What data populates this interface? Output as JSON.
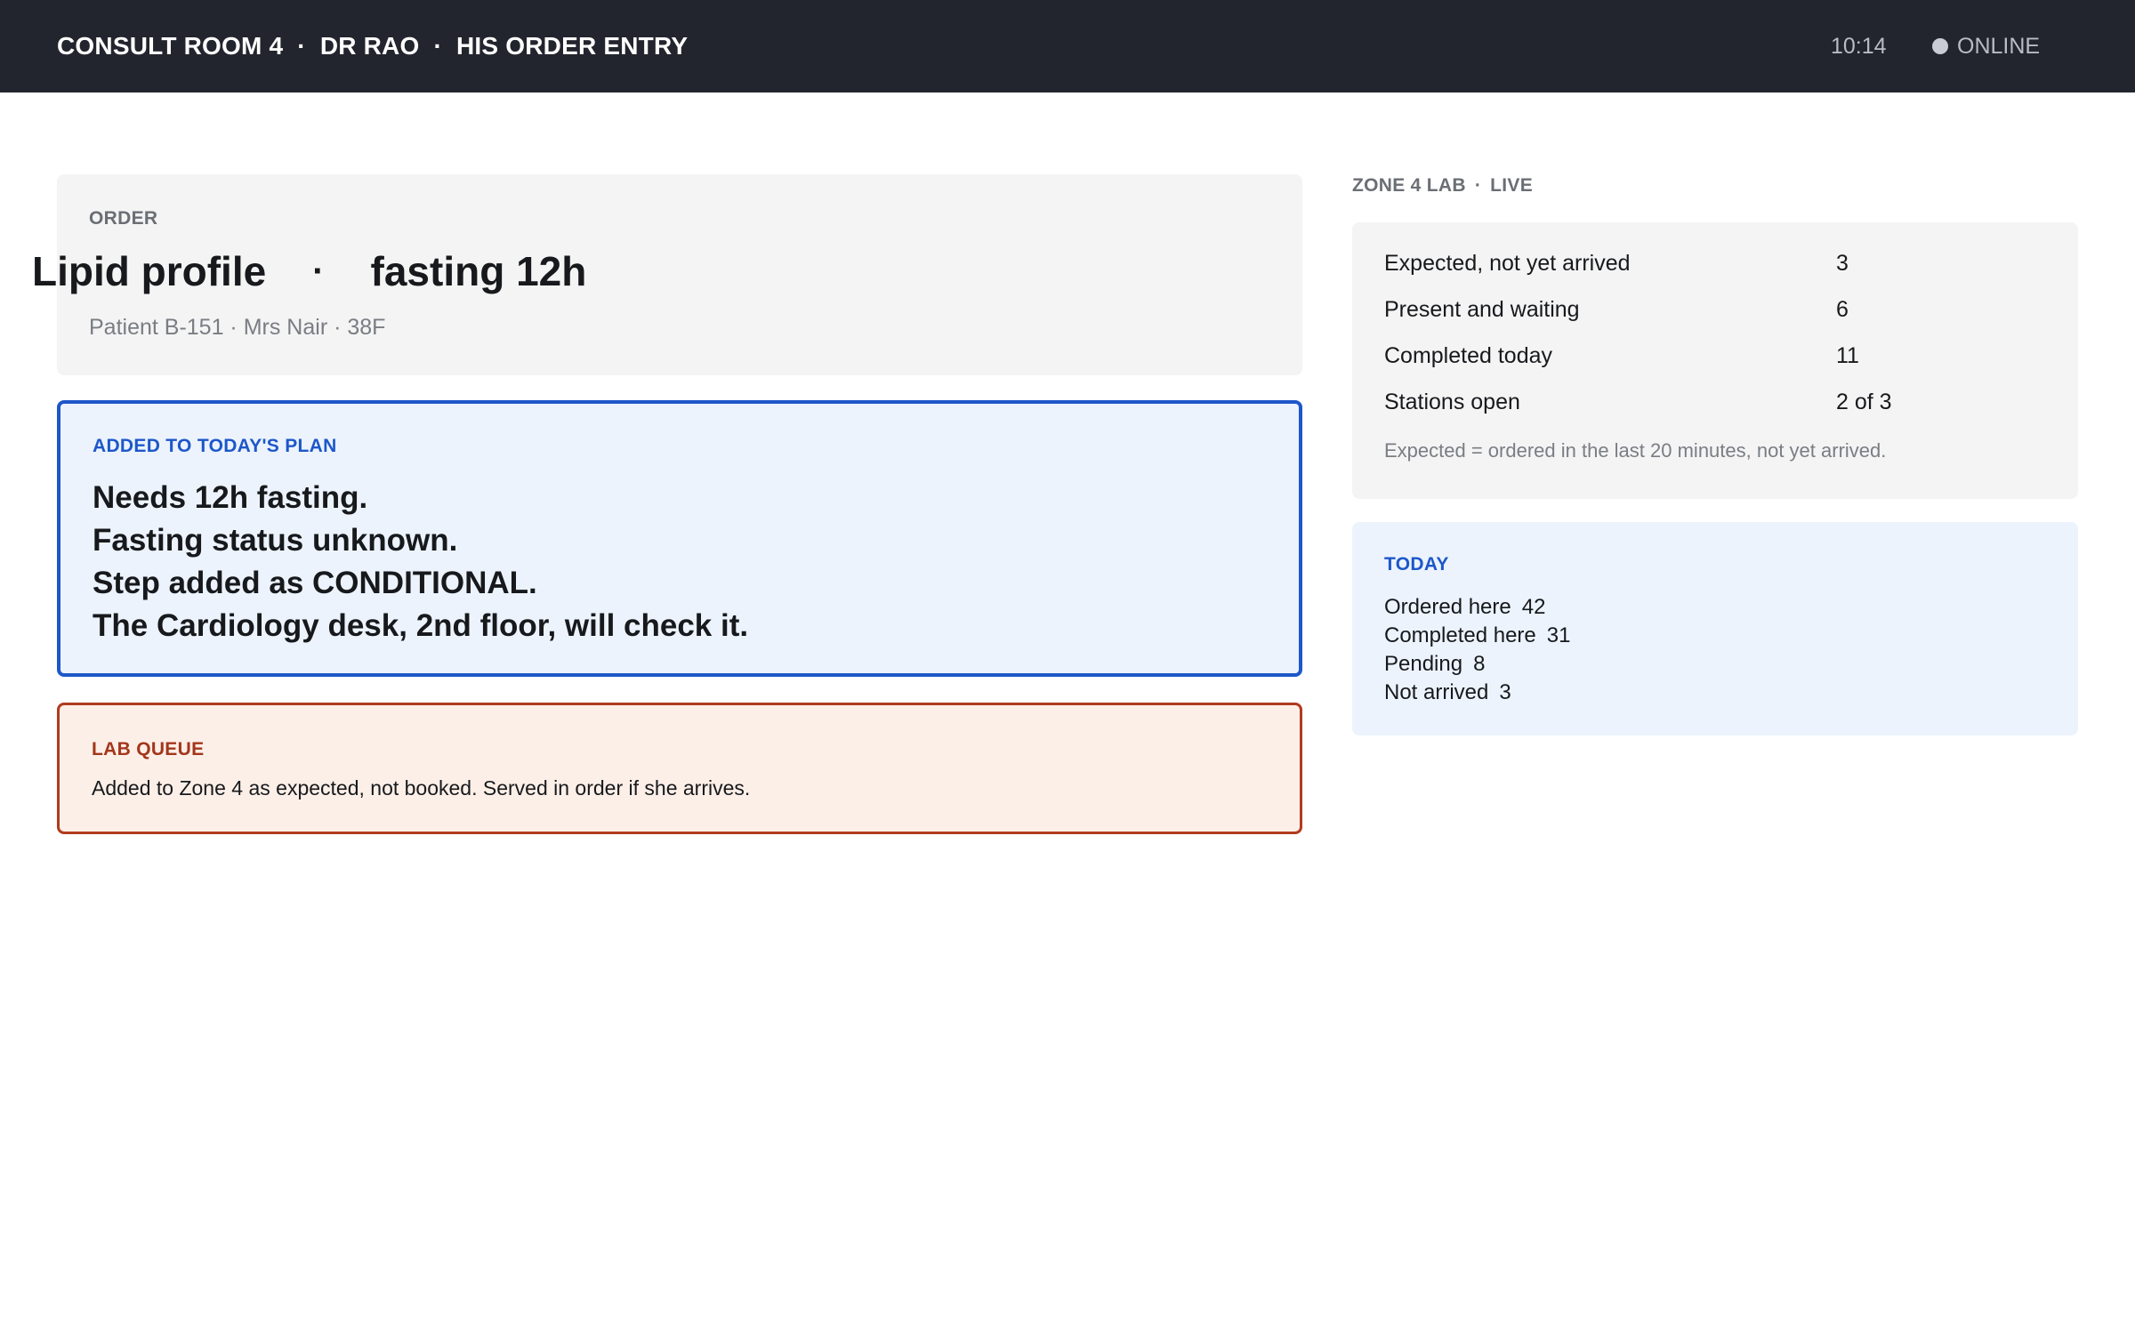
{
  "topbar": {
    "room": "CONSULT ROOM 4",
    "doctor": "DR RAO",
    "screen": "HIS ORDER ENTRY",
    "separator": "·",
    "time": "10:14",
    "status": "ONLINE"
  },
  "order": {
    "eyebrow": "ORDER",
    "test": "Lipid profile",
    "bullet": "·",
    "prep": "fasting 12h",
    "patient": "Patient B-151 · Mrs Nair · 38F"
  },
  "plan": {
    "eyebrow": "ADDED TO TODAY'S PLAN",
    "lines": [
      "Needs 12h fasting.",
      "Fasting status unknown.",
      "Step added as CONDITIONAL.",
      "The Cardiology desk, 2nd floor, will check it."
    ]
  },
  "lab_queue": {
    "eyebrow": "LAB QUEUE",
    "text": "Added to Zone 4 as expected, not booked. Served in order if she arrives."
  },
  "zone_lab": {
    "name": "ZONE 4 LAB",
    "separator": "·",
    "live": "LIVE",
    "rows": [
      {
        "label": "Expected, not yet arrived",
        "value": "3"
      },
      {
        "label": "Present and waiting",
        "value": "6"
      },
      {
        "label": "Completed today",
        "value": "11"
      },
      {
        "label": "Stations open",
        "value": "2 of 3"
      }
    ],
    "note": "Expected = ordered in the last 20 minutes, not yet arrived."
  },
  "today": {
    "eyebrow": "TODAY",
    "items": [
      {
        "label": "Ordered here",
        "value": "42"
      },
      {
        "label": "Completed here",
        "value": "31"
      },
      {
        "label": "Pending",
        "value": "8"
      },
      {
        "label": "Not arrived",
        "value": "3"
      }
    ]
  },
  "colors": {
    "topbar_bg": "#22252d",
    "plan_accent": "#1d57c9",
    "queue_accent": "#b23a1e",
    "panel_bg": "#f4f4f4",
    "plan_bg": "#ecf3fd",
    "queue_bg": "#fcefe8"
  }
}
